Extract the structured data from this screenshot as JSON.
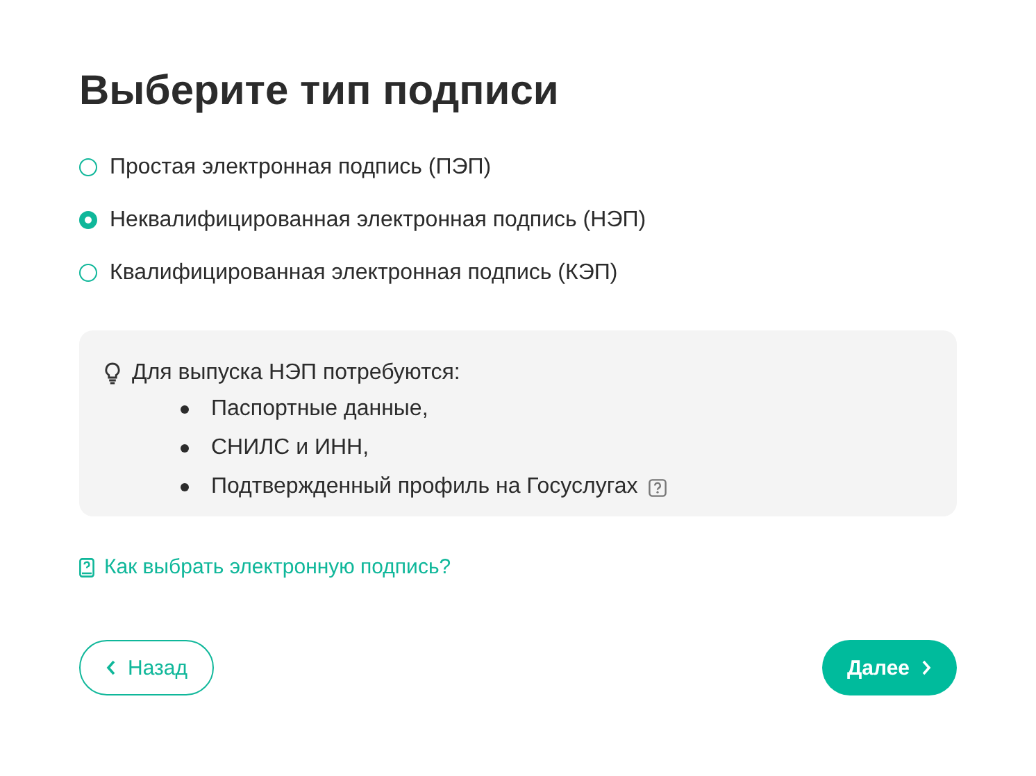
{
  "title": "Выберите тип подписи",
  "options": [
    {
      "label": "Простая электронная подпись (ПЭП)",
      "selected": false
    },
    {
      "label": "Неквалифицированная электронная подпись (НЭП)",
      "selected": true
    },
    {
      "label": "Квалифицированная электронная подпись (КЭП)",
      "selected": false
    }
  ],
  "info": {
    "heading": "Для выпуска НЭП потребуются:",
    "items": [
      {
        "text": "Паспортные данные,",
        "help": false
      },
      {
        "text": "СНИЛС и ИНН,",
        "help": false
      },
      {
        "text": "Подтвержденный профиль на Госуслугах",
        "help": true
      }
    ]
  },
  "help_link": "Как выбрать электронную подпись?",
  "buttons": {
    "back": "Назад",
    "next": "Далее"
  }
}
